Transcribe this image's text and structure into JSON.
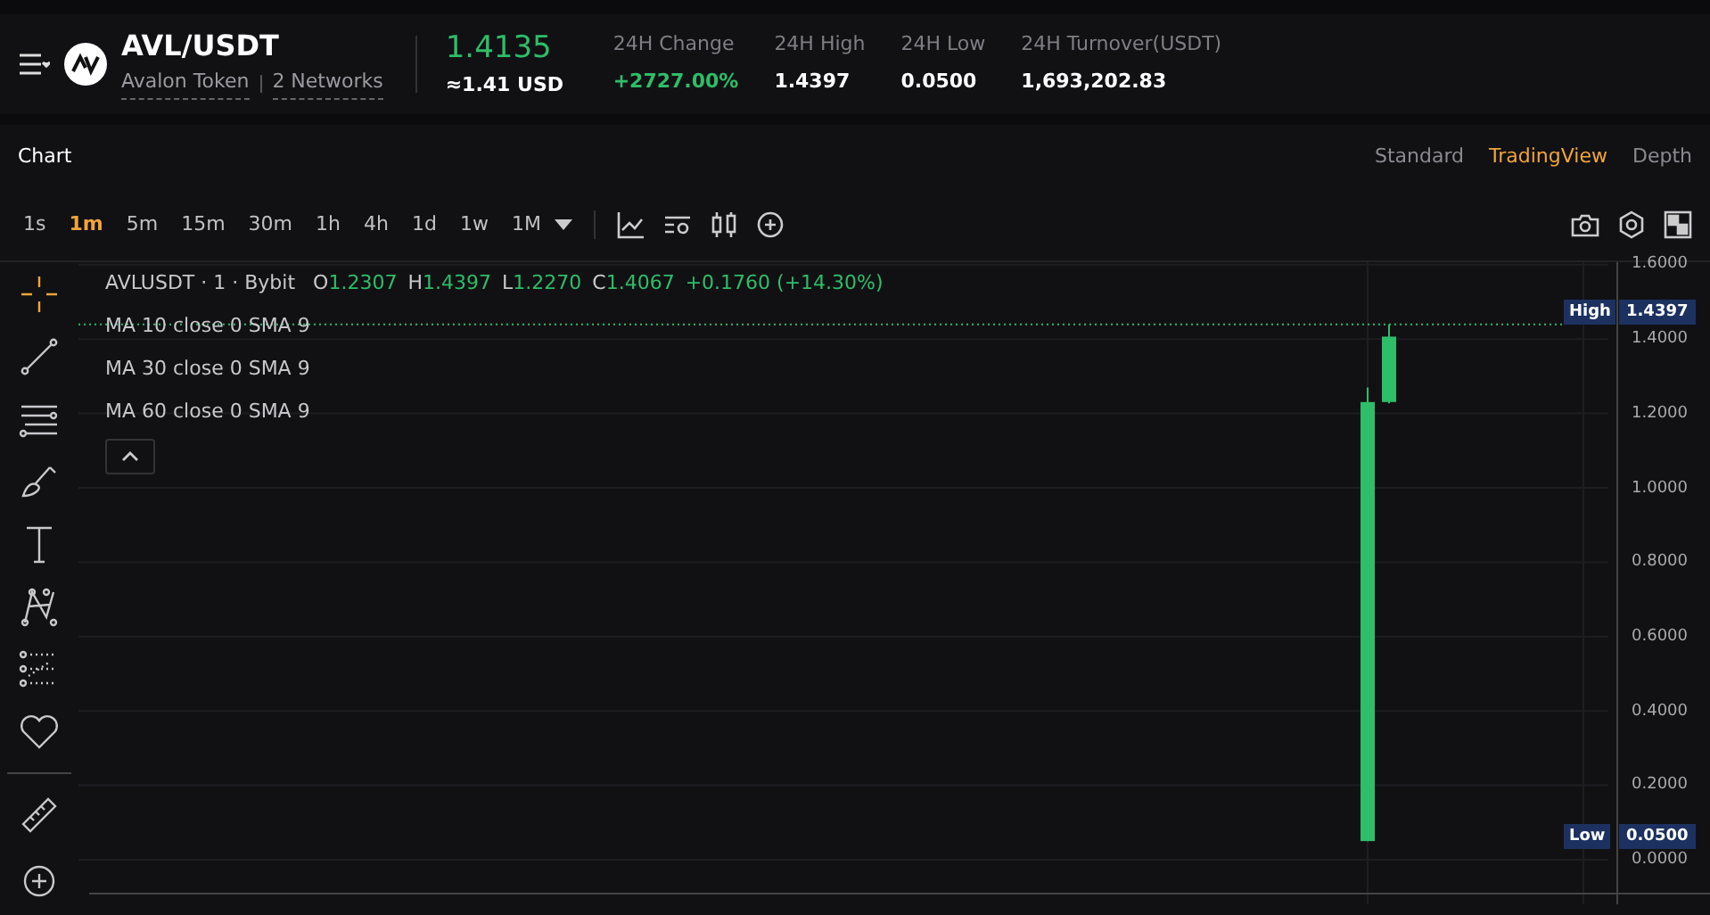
{
  "header": {
    "pair": "AVL/USDT",
    "token_name": "Avalon Token",
    "networks": "2 Networks",
    "price": "1.4135",
    "price_usd": "≈1.41 USD",
    "stats": [
      {
        "label": "24H Change",
        "value": "+2727.00%",
        "kind": "change"
      },
      {
        "label": "24H High",
        "value": "1.4397",
        "kind": "plain"
      },
      {
        "label": "24H Low",
        "value": "0.0500",
        "kind": "plain"
      },
      {
        "label": "24H Turnover(USDT)",
        "value": "1,693,202.83",
        "kind": "plain"
      }
    ]
  },
  "panel": {
    "title": "Chart",
    "views": [
      {
        "label": "Standard",
        "selected": false
      },
      {
        "label": "TradingView",
        "selected": true
      },
      {
        "label": "Depth",
        "selected": false
      }
    ]
  },
  "intervals": [
    {
      "label": "1s",
      "selected": false
    },
    {
      "label": "1m",
      "selected": true
    },
    {
      "label": "5m",
      "selected": false
    },
    {
      "label": "15m",
      "selected": false
    },
    {
      "label": "30m",
      "selected": false
    },
    {
      "label": "1h",
      "selected": false
    },
    {
      "label": "4h",
      "selected": false
    },
    {
      "label": "1d",
      "selected": false
    },
    {
      "label": "1w",
      "selected": false
    },
    {
      "label": "1M",
      "selected": false
    }
  ],
  "legend": {
    "symbol": "AVLUSDT · 1 · Bybit",
    "ohlc": [
      {
        "key": "O",
        "value": "1.2307"
      },
      {
        "key": "H",
        "value": "1.4397"
      },
      {
        "key": "L",
        "value": "1.2270"
      },
      {
        "key": "C",
        "value": "1.4067"
      }
    ],
    "change": "+0.1760 (+14.30%)",
    "indicators": [
      "MA 10 close 0 SMA 9",
      "MA 30 close 0 SMA 9",
      "MA 60 close 0 SMA 9"
    ]
  },
  "y_axis": [
    "1.6000",
    "1.4000",
    "1.2000",
    "1.0000",
    "0.8000",
    "0.6000",
    "0.4000",
    "0.2000",
    "0.0000"
  ],
  "markers": [
    {
      "label": "High",
      "value": "1.4397",
      "kind": "high"
    },
    {
      "label": "Low",
      "value": "0.0500",
      "kind": "low"
    }
  ]
}
